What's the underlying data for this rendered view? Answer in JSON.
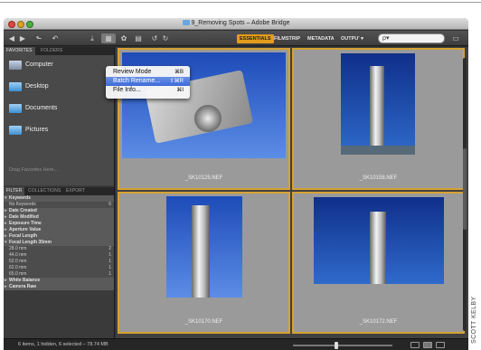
{
  "window": {
    "title": "9_Removing Spots – Adobe Bridge"
  },
  "toolbar": {
    "workspaces": [
      {
        "label": "ESSENTIALS",
        "active": true
      },
      {
        "label": "FILMSTRIP",
        "active": false
      },
      {
        "label": "METADATA",
        "active": false
      },
      {
        "label": "OUTPU' ▾",
        "active": false
      }
    ],
    "search_placeholder": "ρ▾"
  },
  "dropdown": {
    "items": [
      {
        "label": "Review Mode",
        "shortcut": "⌘B",
        "highlighted": false
      },
      {
        "label": "Batch Rename...",
        "shortcut": "⇧⌘R",
        "highlighted": true
      },
      {
        "label": "File Info...",
        "shortcut": "⌘I",
        "highlighted": false
      }
    ]
  },
  "top_tabs": [
    "FAVORITES",
    "FOLDERS"
  ],
  "favorites": [
    {
      "label": "Computer",
      "icon": "computer-icon"
    },
    {
      "label": "Desktop",
      "icon": "folder-icon"
    },
    {
      "label": "Documents",
      "icon": "folder-icon"
    },
    {
      "label": "Pictures",
      "icon": "folder-icon"
    }
  ],
  "favorites_hint": "Drag Favorites Here...",
  "filter_tabs": [
    "FILTER",
    "COLLECTIONS",
    "EXPORT"
  ],
  "filter": [
    {
      "label": "Keywords",
      "type": "head",
      "count": ""
    },
    {
      "label": "No Keywords",
      "type": "item",
      "count": "6"
    },
    {
      "label": "Date Created",
      "type": "head-closed",
      "count": ""
    },
    {
      "label": "Date Modified",
      "type": "head-closed",
      "count": ""
    },
    {
      "label": "Exposure Time",
      "type": "head-closed",
      "count": ""
    },
    {
      "label": "Aperture Value",
      "type": "head-closed",
      "count": ""
    },
    {
      "label": "Focal Length",
      "type": "head-closed",
      "count": ""
    },
    {
      "label": "Focal Length 35mm",
      "type": "head",
      "count": ""
    },
    {
      "label": "28.0 mm",
      "type": "item",
      "count": "2"
    },
    {
      "label": "44.0 mm",
      "type": "item",
      "count": "1"
    },
    {
      "label": "52.0 mm",
      "type": "item",
      "count": "1"
    },
    {
      "label": "62.0 mm",
      "type": "item",
      "count": "1"
    },
    {
      "label": "65.0 mm",
      "type": "item",
      "count": "1"
    },
    {
      "label": "White Balance",
      "type": "head-closed",
      "count": ""
    },
    {
      "label": "Camera Raw",
      "type": "head-closed",
      "count": ""
    }
  ],
  "thumbnails": [
    {
      "filename": "_SK10125.NEF"
    },
    {
      "filename": "_SK10158.NEF"
    },
    {
      "filename": "_SK10170.NEF"
    },
    {
      "filename": "_SK10172.NEF"
    }
  ],
  "status": {
    "text": "6 items, 1 hidden, 6 selected – 78.74 MB"
  },
  "credit": "SCOTT KELBY",
  "colors": {
    "accent": "#e39b1b",
    "selection_border": "#d6a233",
    "menu_highlight": "#3d6ad8"
  }
}
